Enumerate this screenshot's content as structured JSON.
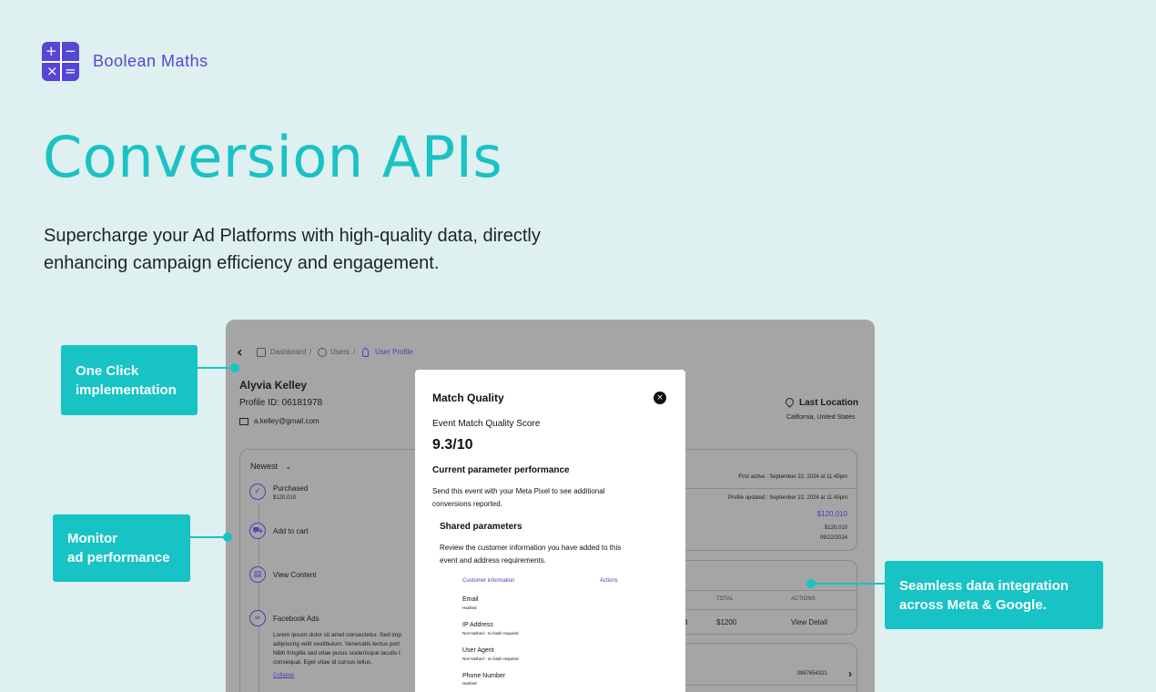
{
  "brand": {
    "name": "Boolean Maths",
    "mark_glyphs": [
      "+",
      "−",
      "×",
      "="
    ],
    "color": "#5546d4"
  },
  "hero": {
    "title": "Conversion APIs",
    "subtitle_line1": "Supercharge your Ad Platforms with high-quality data, directly",
    "subtitle_line2": "enhancing campaign efficiency and engagement."
  },
  "callouts": {
    "one_click": {
      "line1": "One Click",
      "line2": "implementation"
    },
    "monitor": {
      "line1": "Monitor",
      "line2": "ad performance"
    },
    "seamless": {
      "line1": "Seamless data integration",
      "line2": "across Meta & Google."
    }
  },
  "app": {
    "breadcrumb": {
      "dashboard": "Dashboard",
      "sep": "/",
      "users": "Users",
      "current": "User Profile"
    },
    "profile": {
      "name": "Alyvia Kelley",
      "profile_id": "Profile ID: 06181978",
      "email": "a.kelley@gmail.com"
    },
    "location": {
      "label": "Last Location",
      "value": "California, United States"
    },
    "activity": {
      "sort_label": "Newest",
      "items": [
        {
          "title": "Purchased",
          "sub": "$120,010"
        },
        {
          "title": "Add to cart"
        },
        {
          "title": "View Content"
        },
        {
          "title": "Facebook Ads"
        }
      ],
      "body": [
        "Lorem ipsum dolor sit amet consectetur. Sed imp",
        "adipiscing velit vestibulum. Venenatis lectus port",
        "Nibh fringilla sed vitae purus scelerisque iaculis t",
        "consequat. Eget vitae id cursus tellus."
      ],
      "collapse": "Collapse"
    },
    "summary": {
      "first_active": "First active : September 22, 2024 at 11:45pm",
      "profile_updated": "Profile updated : September 22, 2024 at 11:45pm",
      "amount_highlight": "$120,010",
      "amount": "$120,010",
      "date": "09/22/2024"
    },
    "orders": {
      "col_total": "TOTAL",
      "col_actions": "ACTIONS",
      "row_partial": "3",
      "row_total": "$1200",
      "row_action": "View Detail"
    },
    "contact": {
      "phone": "0987654321",
      "chevron": "›"
    }
  },
  "modal": {
    "title": "Match Quality",
    "close": "×",
    "score_label": "Event Match Quality Score",
    "score": "9.3/10",
    "section_title": "Current parameter performance",
    "section_desc_line1": "Send this event with your Meta Pixel to see additional",
    "section_desc_line2": "conversions reported.",
    "shared_title": "Shared parameters",
    "shared_desc_line1": "Review the customer information you have added to this",
    "shared_desc_line2": "event and address requirements.",
    "table_head": {
      "col1": "Customer information",
      "col2": "Actions"
    },
    "params": [
      {
        "name": "Email",
        "status": "Hashed"
      },
      {
        "name": "IP Address",
        "status": "Not Hashed - no hash required"
      },
      {
        "name": "User Agent",
        "status": "Not Hashed - no hash required"
      },
      {
        "name": "Phone Number",
        "status": "Hashed"
      }
    ]
  },
  "colors": {
    "accent": "#17c3c4",
    "brand": "#5546d4",
    "background": "#def0f0",
    "overlay": "#a5a5a6"
  }
}
